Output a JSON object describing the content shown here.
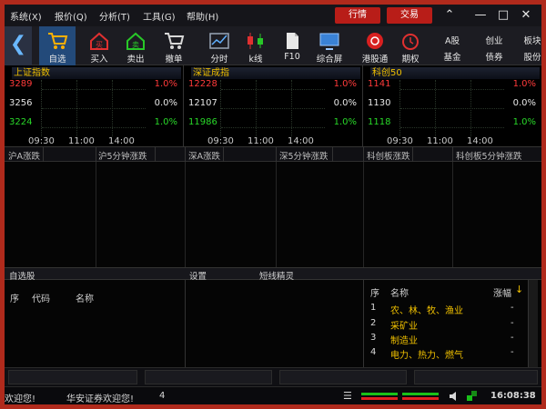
{
  "menu": [
    "系统(X)",
    "报价(Q)",
    "分析(T)",
    "工具(G)",
    "帮助(H)"
  ],
  "header_buttons": {
    "quote": "行情",
    "trade": "交易"
  },
  "toolbar": [
    {
      "label": "自选",
      "icon": "cart-icon"
    },
    {
      "label": "买入",
      "icon": "buy-house-icon"
    },
    {
      "label": "卖出",
      "icon": "sell-house-icon"
    },
    {
      "label": "撤单",
      "icon": "cancel-order-cart-icon"
    },
    {
      "label": "分时",
      "icon": "intraday-chart-icon"
    },
    {
      "label": "k线",
      "icon": "candlestick-icon"
    },
    {
      "label": "F10",
      "icon": "f10-document-icon"
    },
    {
      "label": "综合屏",
      "icon": "monitor-icon"
    },
    {
      "label": "港股通",
      "icon": "hk-connect-icon"
    },
    {
      "label": "期权",
      "icon": "option-clock-icon"
    }
  ],
  "toolbar_text": {
    "a_shares": "A股",
    "funds": "基金",
    "innovation": "创业",
    "bonds": "债券",
    "board": "板块",
    "shares": "股份"
  },
  "indices": [
    {
      "title": "上证指数",
      "high": "3289",
      "mid": "3256",
      "low": "3224",
      "pct_high": "1.0%",
      "pct_mid": "0.0%",
      "pct_low": "1.0%",
      "times": [
        "09:30",
        "11:00",
        "14:00"
      ]
    },
    {
      "title": "深证成指",
      "high": "12228",
      "mid": "12107",
      "low": "11986",
      "pct_high": "1.0%",
      "pct_mid": "0.0%",
      "pct_low": "1.0%",
      "times": [
        "09:30",
        "11:00",
        "14:00"
      ]
    },
    {
      "title": "科创50",
      "high": "1141",
      "mid": "1130",
      "low": "1118",
      "pct_high": "1.0%",
      "pct_mid": "0.0%",
      "pct_low": "1.0%",
      "times": [
        "09:30",
        "11:00",
        "14:00"
      ]
    }
  ],
  "ranking_headers": [
    "沪A涨跌",
    "沪5分钟涨跌",
    "深A涨跌",
    "深5分钟涨跌",
    "科创板涨跌",
    "科创板5分钟涨跌"
  ],
  "section_headers": {
    "watchlist": "自选股",
    "settings": "设置",
    "short_line": "短线精灵"
  },
  "watchlist_columns": {
    "seq": "序",
    "code": "代码",
    "name": "名称"
  },
  "industry": {
    "columns": {
      "seq": "序",
      "name": "名称",
      "change": "涨幅"
    },
    "rows": [
      {
        "seq": "1",
        "name": "农、林、牧、渔业",
        "change": "-"
      },
      {
        "seq": "2",
        "name": "采矿业",
        "change": "-"
      },
      {
        "seq": "3",
        "name": "制造业",
        "change": "-"
      },
      {
        "seq": "4",
        "name": "电力、热力、燃气",
        "change": "-"
      }
    ]
  },
  "ticker": {
    "welcome1": "欢迎您!",
    "welcome2": "华安证券欢迎您!",
    "count": "4",
    "time": "16:08:38"
  },
  "colors": {
    "up": "#ff3a3a",
    "down": "#29d829",
    "accent": "#b81d18",
    "highlight": "#f0c000"
  }
}
